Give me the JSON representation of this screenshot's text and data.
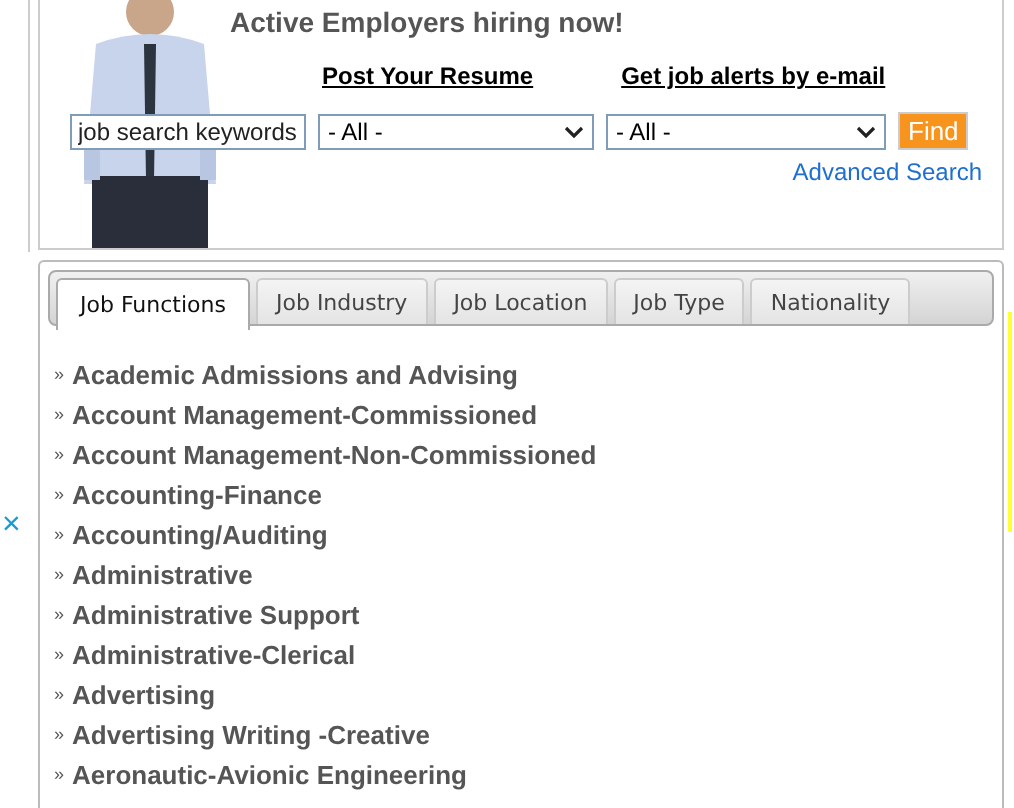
{
  "header": {
    "headline": "Active Employers hiring now!",
    "links": [
      "Post Your Resume",
      "Get job alerts by e-mail"
    ],
    "search": {
      "placeholder": "job search keywords",
      "select_1": "- All -",
      "select_2": "- All -",
      "button": "Find"
    },
    "advanced_link": "Advanced Search"
  },
  "ad_close": "×",
  "tabs": [
    {
      "label": "Job Functions",
      "selected": true
    },
    {
      "label": "Job Industry",
      "selected": false
    },
    {
      "label": "Job Location",
      "selected": false
    },
    {
      "label": "Job Type",
      "selected": false
    },
    {
      "label": "Nationality",
      "selected": false
    }
  ],
  "bullet": "»",
  "categories": [
    "Academic Admissions and Advising",
    "Account Management-Commissioned",
    "Account Management-Non-Commissioned",
    "Accounting-Finance",
    "Accounting/Auditing",
    "Administrative",
    "Administrative Support",
    "Administrative-Clerical",
    "Advertising",
    "Advertising Writing -Creative",
    "Aeronautic-Avionic Engineering"
  ]
}
